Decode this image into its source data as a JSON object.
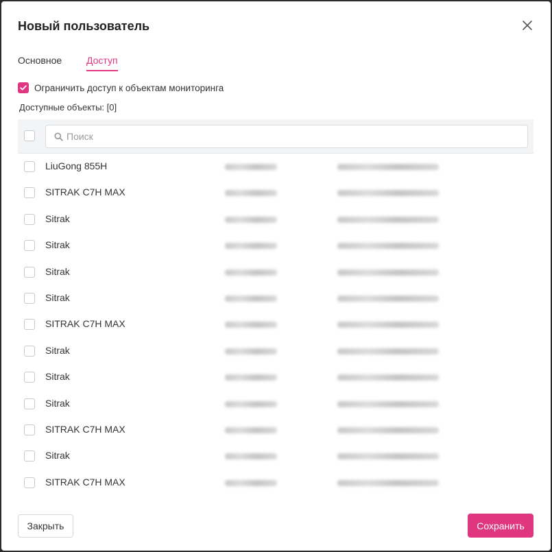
{
  "dialog": {
    "title": "Новый пользователь"
  },
  "tabs": [
    {
      "label": "Основное",
      "active": false
    },
    {
      "label": "Доступ",
      "active": true
    }
  ],
  "restrict": {
    "label": "Ограничить доступ к объектам мониторинга",
    "checked": true
  },
  "available": {
    "label": "Доступные объекты: [0]"
  },
  "search": {
    "placeholder": "Поиск",
    "value": ""
  },
  "objects": [
    {
      "name": "LiuGong 855H"
    },
    {
      "name": "SITRAK C7H MAX"
    },
    {
      "name": "Sitrak"
    },
    {
      "name": "Sitrak"
    },
    {
      "name": "Sitrak"
    },
    {
      "name": "Sitrak"
    },
    {
      "name": "SITRAK C7H MAX"
    },
    {
      "name": "Sitrak"
    },
    {
      "name": "Sitrak"
    },
    {
      "name": "Sitrak"
    },
    {
      "name": "SITRAK C7H MAX"
    },
    {
      "name": "Sitrak"
    },
    {
      "name": "SITRAK C7H MAX"
    }
  ],
  "buttons": {
    "close_label": "Закрыть",
    "save_label": "Сохранить"
  },
  "colors": {
    "accent": "#e0367f"
  }
}
